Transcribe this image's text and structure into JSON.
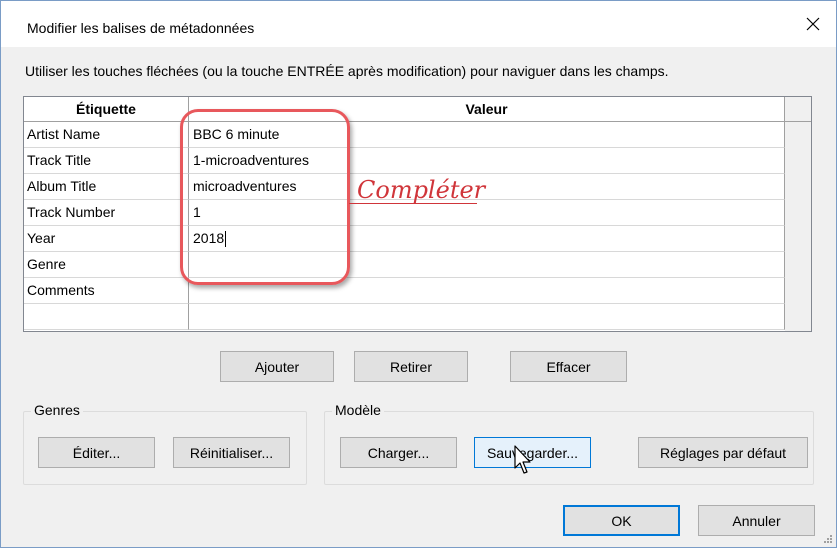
{
  "window": {
    "title": "Modifier les balises de métadonnées",
    "close_icon": "close-icon"
  },
  "instruction": "Utiliser les touches fléchées (ou la touche ENTRÉE après modification) pour naviguer dans les champs.",
  "grid": {
    "headers": [
      "Étiquette",
      "Valeur"
    ],
    "rows": [
      {
        "label": "Artist Name",
        "value": "BBC 6 minute"
      },
      {
        "label": "Track Title",
        "value": "1-microadventures"
      },
      {
        "label": "Album Title",
        "value": "microadventures"
      },
      {
        "label": "Track Number",
        "value": "1"
      },
      {
        "label": "Year",
        "value": "2018"
      },
      {
        "label": "Genre",
        "value": ""
      },
      {
        "label": "Comments",
        "value": ""
      },
      {
        "label": "",
        "value": ""
      }
    ]
  },
  "annotation": {
    "text": "Compléter",
    "color": "#e8585c"
  },
  "row_buttons": {
    "add": "Ajouter",
    "remove": "Retirer",
    "clear": "Effacer"
  },
  "genres": {
    "label": "Genres",
    "edit": "Éditer...",
    "reset": "Réinitialiser..."
  },
  "template": {
    "label": "Modèle",
    "load": "Charger...",
    "save": "Sauvegarder...",
    "defaults": "Réglages par défaut"
  },
  "footer": {
    "ok": "OK",
    "cancel": "Annuler"
  },
  "colors": {
    "accent": "#0078d7",
    "annotation": "#e8585c"
  }
}
